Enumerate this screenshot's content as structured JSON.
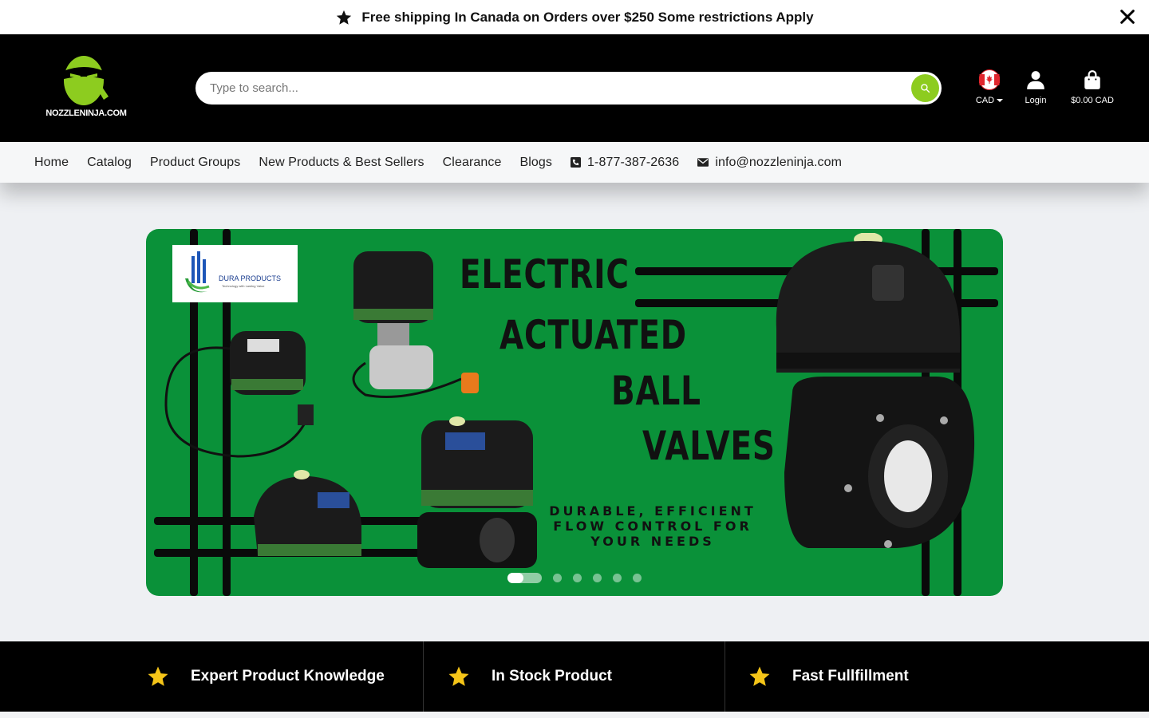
{
  "announcement": {
    "text": "Free shipping In Canada on Orders over $250 Some restrictions Apply",
    "icon": "star-icon",
    "close_icon": "close-icon"
  },
  "header": {
    "brand": "NOZZLENINJA.COM",
    "search": {
      "placeholder": "Type to search...",
      "button_icon": "search-icon"
    },
    "currency": {
      "label": "CAD",
      "flag": "canada-flag-icon"
    },
    "login": {
      "label": "Login",
      "icon": "user-icon"
    },
    "cart": {
      "label": "$0.00 CAD",
      "icon": "shopping-bag-icon"
    }
  },
  "nav": {
    "items": [
      "Home",
      "Catalog",
      "Product Groups",
      "New Products & Best Sellers",
      "Clearance",
      "Blogs"
    ],
    "phone": "1-877-387-2636",
    "email": "info@nozzleninja.com"
  },
  "banner": {
    "partner": "DURA PRODUCTS",
    "partner_tagline": "Technology with Lasting Value",
    "title_lines": [
      "ELECTRIC",
      "ACTUATED",
      "BALL",
      "VALVES"
    ],
    "subtitle_lines": [
      "DURABLE, EFFICIENT",
      "FLOW CONTROL FOR",
      "YOUR NEEDS"
    ],
    "slides_total": 6,
    "active_slide": 1
  },
  "features": [
    "Expert Product Knowledge",
    "In Stock Product",
    "Fast Fullfillment"
  ],
  "colors": {
    "accent": "#8dcc1f",
    "banner_green": "#0a9139",
    "star_yellow": "#f5c518"
  }
}
